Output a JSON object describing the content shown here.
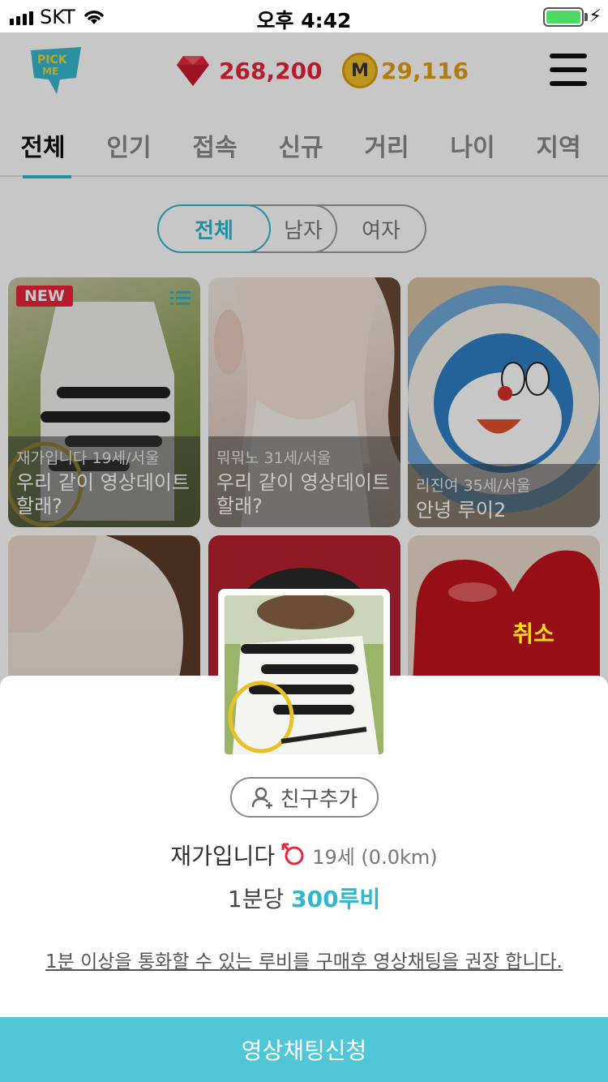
{
  "status_bar": {
    "carrier": "SKT",
    "time": "오후 4:42"
  },
  "header": {
    "logo_text": "PICK ME",
    "ruby_count": "268,200",
    "coin_label": "M",
    "coin_count": "29,116"
  },
  "tabs": [
    {
      "label": "전체",
      "active": true
    },
    {
      "label": "인기",
      "active": false
    },
    {
      "label": "접속",
      "active": false
    },
    {
      "label": "신규",
      "active": false
    },
    {
      "label": "거리",
      "active": false
    },
    {
      "label": "나이",
      "active": false
    },
    {
      "label": "지역",
      "active": false
    }
  ],
  "gender_filter": {
    "options": [
      "전체",
      "남자",
      "여자"
    ],
    "selected": "전체"
  },
  "cards": [
    {
      "badge": "NEW",
      "meta": "재가입니다 19세/서울",
      "message": "우리 같이 영상데이트 할래?"
    },
    {
      "badge": "",
      "meta": "뭐뭐노 31세/서울",
      "message": "우리 같이 영상데이트 할래?"
    },
    {
      "badge": "",
      "meta": "리진여 35세/서울",
      "message": "안녕 루이2"
    }
  ],
  "sheet": {
    "cancel_label": "취소",
    "friend_add_label": "친구추가",
    "name": "재가입니다",
    "age_distance": "19세 (0.0km)",
    "rate_prefix": "1분당 ",
    "rate_value": "300루비",
    "notice": "1분 이상을 통화할 수 있는 루비를 구매후 영상채팅을 권장 합니다.",
    "cta_label": "영상채팅신청"
  },
  "colors": {
    "accent": "#2eb7cd",
    "cta": "#50c6d6",
    "ruby": "#e8263b",
    "coin": "#e6a112",
    "cancel": "#ffdb1a"
  }
}
